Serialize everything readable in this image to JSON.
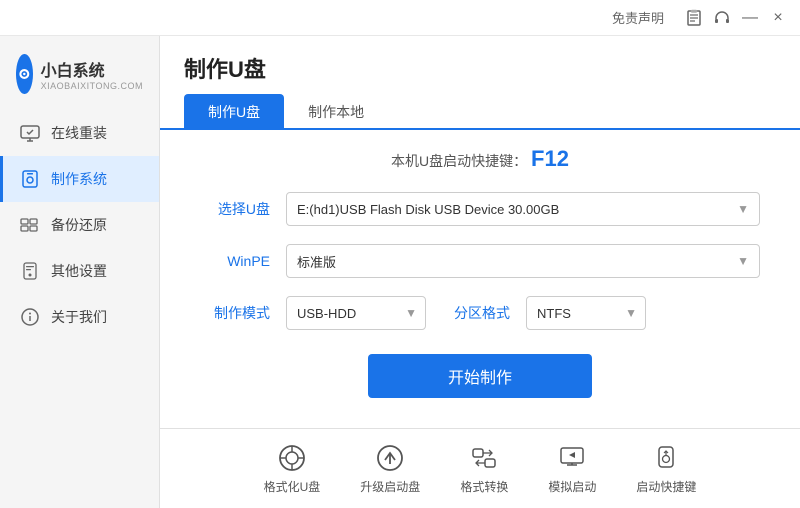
{
  "titlebar": {
    "free_label": "免责声明",
    "minimize_label": "—",
    "close_label": "×",
    "icon1_label": "📋",
    "icon2_label": "🎧"
  },
  "logo": {
    "main": "小白系统",
    "sub": "XIAOBAIXITONG.COM",
    "symbol": "●"
  },
  "nav": {
    "items": [
      {
        "id": "online-reinstall",
        "icon": "🖥",
        "label": "在线重装"
      },
      {
        "id": "make-system",
        "icon": "💾",
        "label": "制作系统",
        "active": true
      },
      {
        "id": "backup-restore",
        "icon": "🗂",
        "label": "备份还原"
      },
      {
        "id": "other-settings",
        "icon": "🔒",
        "label": "其他设置"
      },
      {
        "id": "about-us",
        "icon": "ℹ",
        "label": "关于我们"
      }
    ]
  },
  "page": {
    "title": "制作U盘",
    "tabs": [
      {
        "id": "make-usb",
        "label": "制作U盘",
        "active": true
      },
      {
        "id": "make-local",
        "label": "制作本地"
      }
    ],
    "shortcut_hint": "本机U盘启动快捷键：",
    "shortcut_key": "F12",
    "form": {
      "usb_label": "选择U盘",
      "usb_value": "E:(hd1)USB Flash Disk USB Device 30.00GB",
      "winpe_label": "WinPE",
      "winpe_value": "标准版",
      "mode_label": "制作模式",
      "mode_value": "USB-HDD",
      "partition_label": "分区格式",
      "partition_value": "NTFS"
    },
    "start_button": "开始制作"
  },
  "toolbar": {
    "items": [
      {
        "id": "format-usb",
        "icon": "⊙",
        "label": "格式化U盘"
      },
      {
        "id": "upgrade-boot",
        "icon": "⊕",
        "label": "升级启动盘"
      },
      {
        "id": "format-convert",
        "icon": "⇌",
        "label": "格式转换"
      },
      {
        "id": "simulate-boot",
        "icon": "⊞",
        "label": "模拟启动"
      },
      {
        "id": "boot-shortcut",
        "icon": "🔒",
        "label": "启动快捷键"
      }
    ]
  }
}
